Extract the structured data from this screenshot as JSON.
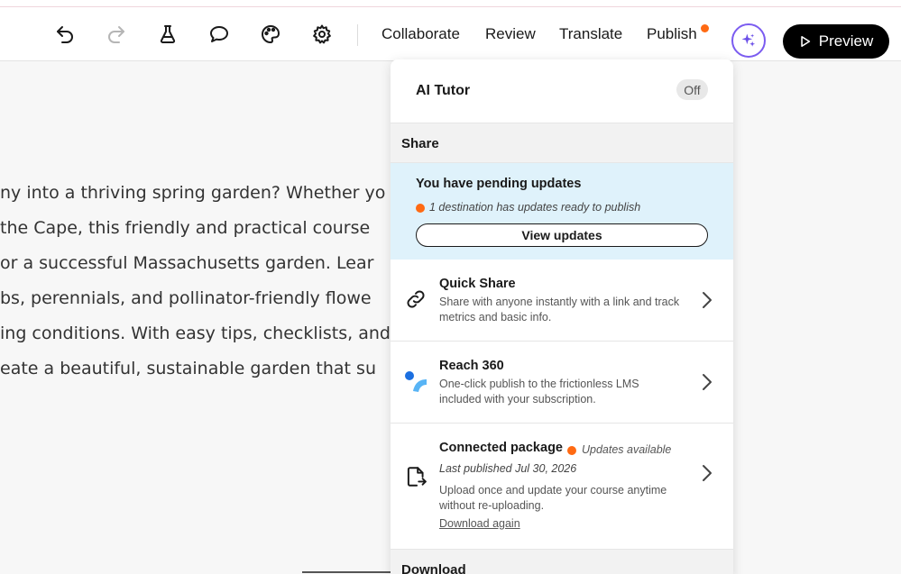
{
  "toolbar": {
    "icons": [
      "undo-icon",
      "redo-icon",
      "flask-icon",
      "comment-icon",
      "palette-icon",
      "gear-icon"
    ],
    "links": [
      "Collaborate",
      "Review",
      "Translate",
      "Publish"
    ],
    "preview_label": "Preview",
    "accent_color": "#7b5cf0",
    "notification_color": "#ff6a13"
  },
  "course": {
    "lines": [
      "ny into a thriving spring garden? Whether yo",
      " the Cape, this friendly and practical course",
      "or a successful Massachusetts garden. Lear",
      "bs, perennials, and pollinator-friendly flowe",
      "ing conditions. With easy tips, checklists, and",
      "eate a beautiful, sustainable garden that su"
    ]
  },
  "panel": {
    "ai_tutor": {
      "label": "AI Tutor",
      "status": "Off"
    },
    "share_header": "Share",
    "pending": {
      "title": "You have pending updates",
      "subtitle": "1 destination has updates ready to publish",
      "button": "View updates",
      "background": "#dff2fb"
    },
    "quick_share": {
      "title": "Quick Share",
      "description": "Share with anyone instantly with a link and track metrics and basic info."
    },
    "reach": {
      "title": "Reach 360",
      "description": "One-click publish to the frictionless LMS included with your subscription."
    },
    "package": {
      "title": "Connected package",
      "status": "Updates available",
      "last_published": "Last published Jul 30, 2026",
      "description": "Upload once and update your course anytime without re-uploading.",
      "link": "Download again"
    },
    "download_header": "Download"
  }
}
